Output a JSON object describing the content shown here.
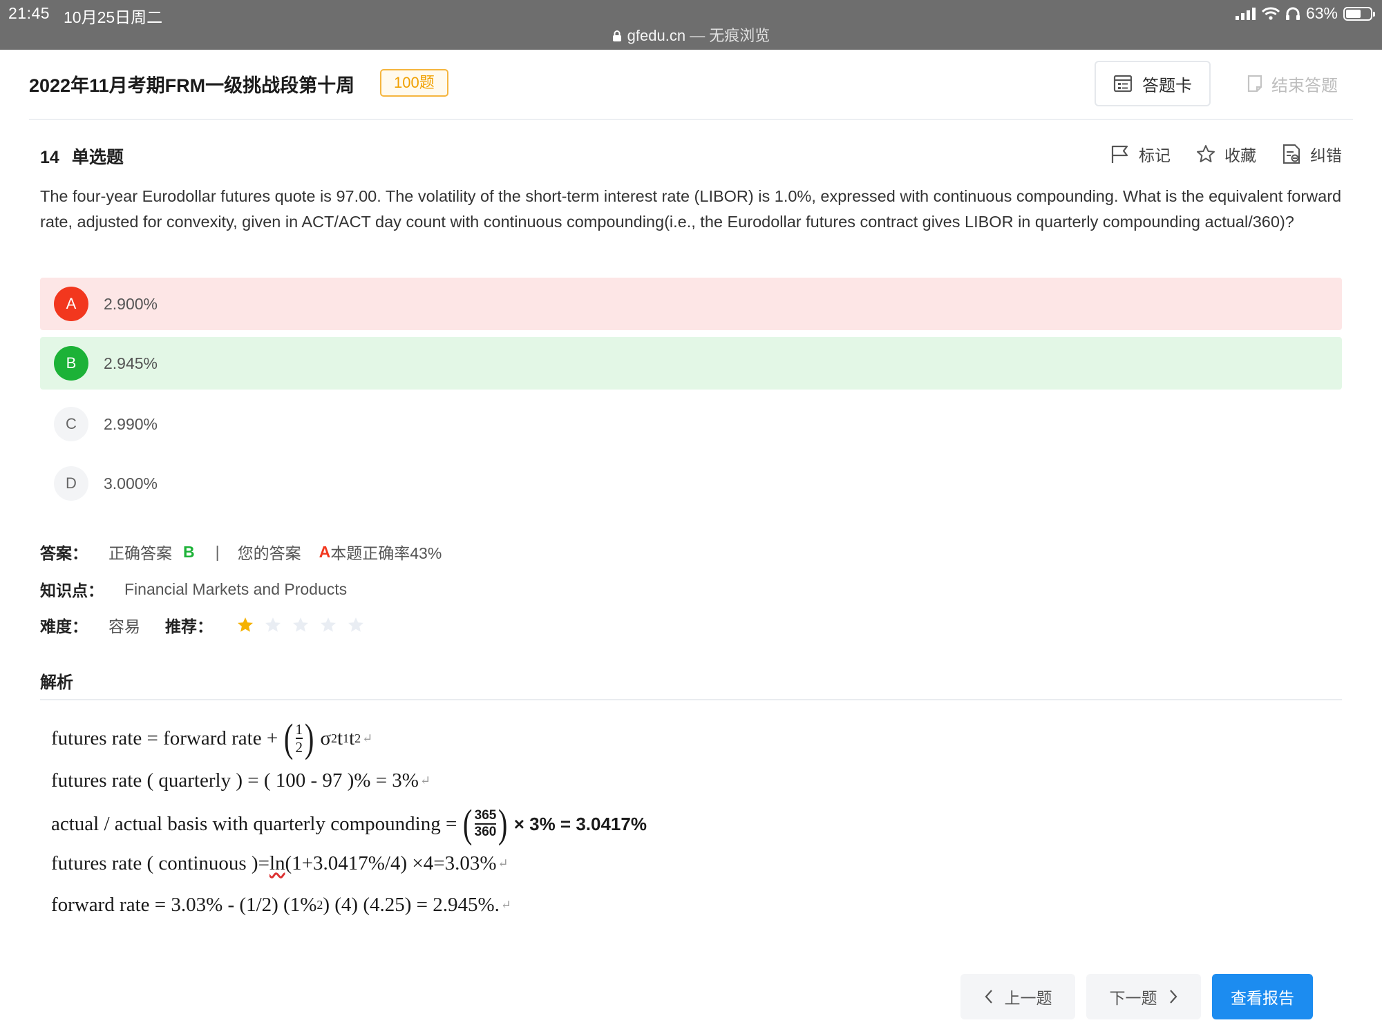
{
  "status_bar": {
    "time": "21:45",
    "date": "10月25日周二",
    "url_domain": "gfedu.cn",
    "url_suffix": " — 无痕浏览",
    "battery": "63%",
    "battery_level": 0.63
  },
  "header": {
    "title": "2022年11月考期FRM一级挑战段第十周",
    "question_count": "100题",
    "answer_card_label": "答题卡",
    "end_label": "结束答题"
  },
  "question": {
    "number": "14",
    "type": "单选题",
    "tools": {
      "mark": "标记",
      "favorite": "收藏",
      "report_error": "纠错"
    },
    "text": "The four-year Eurodollar futures quote is 97.00. The volatility of the short-term interest rate (LIBOR) is 1.0%, expressed with continuous compounding. What is the equivalent forward rate, adjusted for convexity, given in ACT/ACT day count with continuous compounding(i.e., the Eurodollar futures contract gives LIBOR in quarterly compounding actual/360)?",
    "options": [
      {
        "letter": "A",
        "text": "2.900%",
        "state": "wrong"
      },
      {
        "letter": "B",
        "text": "2.945%",
        "state": "correct"
      },
      {
        "letter": "C",
        "text": "2.990%",
        "state": "normal"
      },
      {
        "letter": "D",
        "text": "3.000%",
        "state": "normal"
      }
    ]
  },
  "answer": {
    "label": "答案：",
    "correct_label": "正确答案",
    "correct_value": "B",
    "separator": "|",
    "your_label": "您的答案",
    "your_value": "A",
    "accuracy": "本题正确率43%"
  },
  "knowledge": {
    "label": "知识点：",
    "value": "Financial Markets and Products"
  },
  "difficulty": {
    "label": "难度：",
    "value": "容易",
    "recommend_label": "推荐：",
    "rating": 1,
    "max": 5
  },
  "analysis": {
    "title": "解析",
    "line1": {
      "a": "futures rate = forward rate + ",
      "num": "1",
      "den": "2",
      "b": "σ",
      "sup": "2",
      "c": " t",
      "sub1": "1",
      "d": " t",
      "sub2": "2"
    },
    "line2": "futures rate ( quarterly ) = ( 100 - 97 )% = 3%",
    "line3": {
      "a": "actual / actual basis with quarterly compounding = ",
      "num": "365",
      "den": "360",
      "b": " × 3% = 3.0417%"
    },
    "line4": {
      "a": "futures rate ( continuous )= ",
      "ln": "ln",
      "b": "(1+3.0417%/4) ×4=3.03%"
    },
    "line5": {
      "a": "forward rate = 3.03% - (1/2) (1%",
      "sup": "2",
      "b": ") (4) (4.25) = 2.945%."
    },
    "return_mark": "↵"
  },
  "footer": {
    "prev_label": "上一题",
    "next_label": "下一题",
    "report_label": "查看报告"
  },
  "colors": {
    "accent": "#1c8cf0",
    "wrong": "#f2371e",
    "correct": "#1cb237",
    "badge": "#f0a000"
  }
}
